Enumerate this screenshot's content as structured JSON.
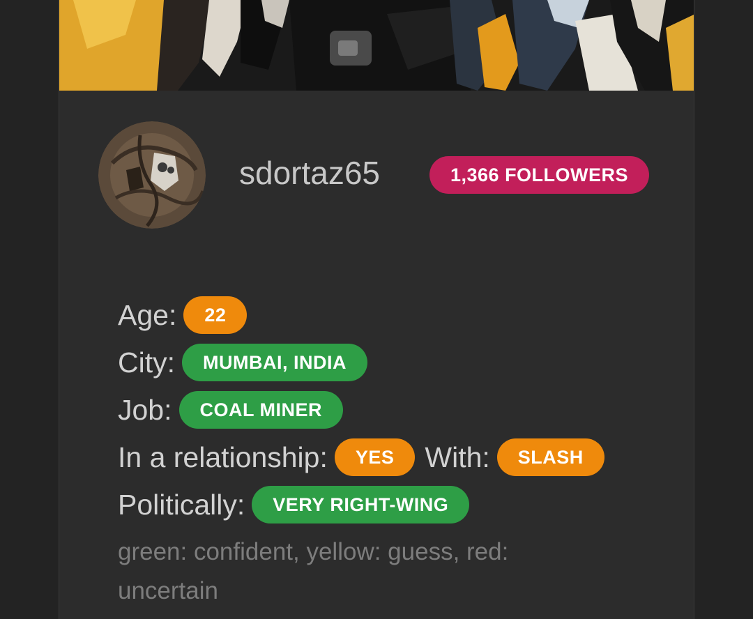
{
  "profile": {
    "username": "sdortaz65",
    "followers": "1,366 FOLLOWERS"
  },
  "details": {
    "age_label": "Age:",
    "age_value": "22",
    "city_label": "City:",
    "city_value": "MUMBAI, INDIA",
    "job_label": "Job:",
    "job_value": "COAL MINER",
    "relationship_label": "In a relationship:",
    "relationship_value": "YES",
    "with_label": "With:",
    "with_value": "SLASH",
    "political_label": "Politically:",
    "political_value": "VERY RIGHT-WING"
  },
  "legend": "green: confident, yellow: guess, red: uncertain",
  "colors": {
    "background": "#232323",
    "card": "#2c2c2c",
    "followers_badge": "#c21f5a",
    "confident": "#2e9e46",
    "guess": "#ef8a0c"
  },
  "icons": {
    "banner": "cover-image",
    "avatar": "profile-avatar"
  }
}
